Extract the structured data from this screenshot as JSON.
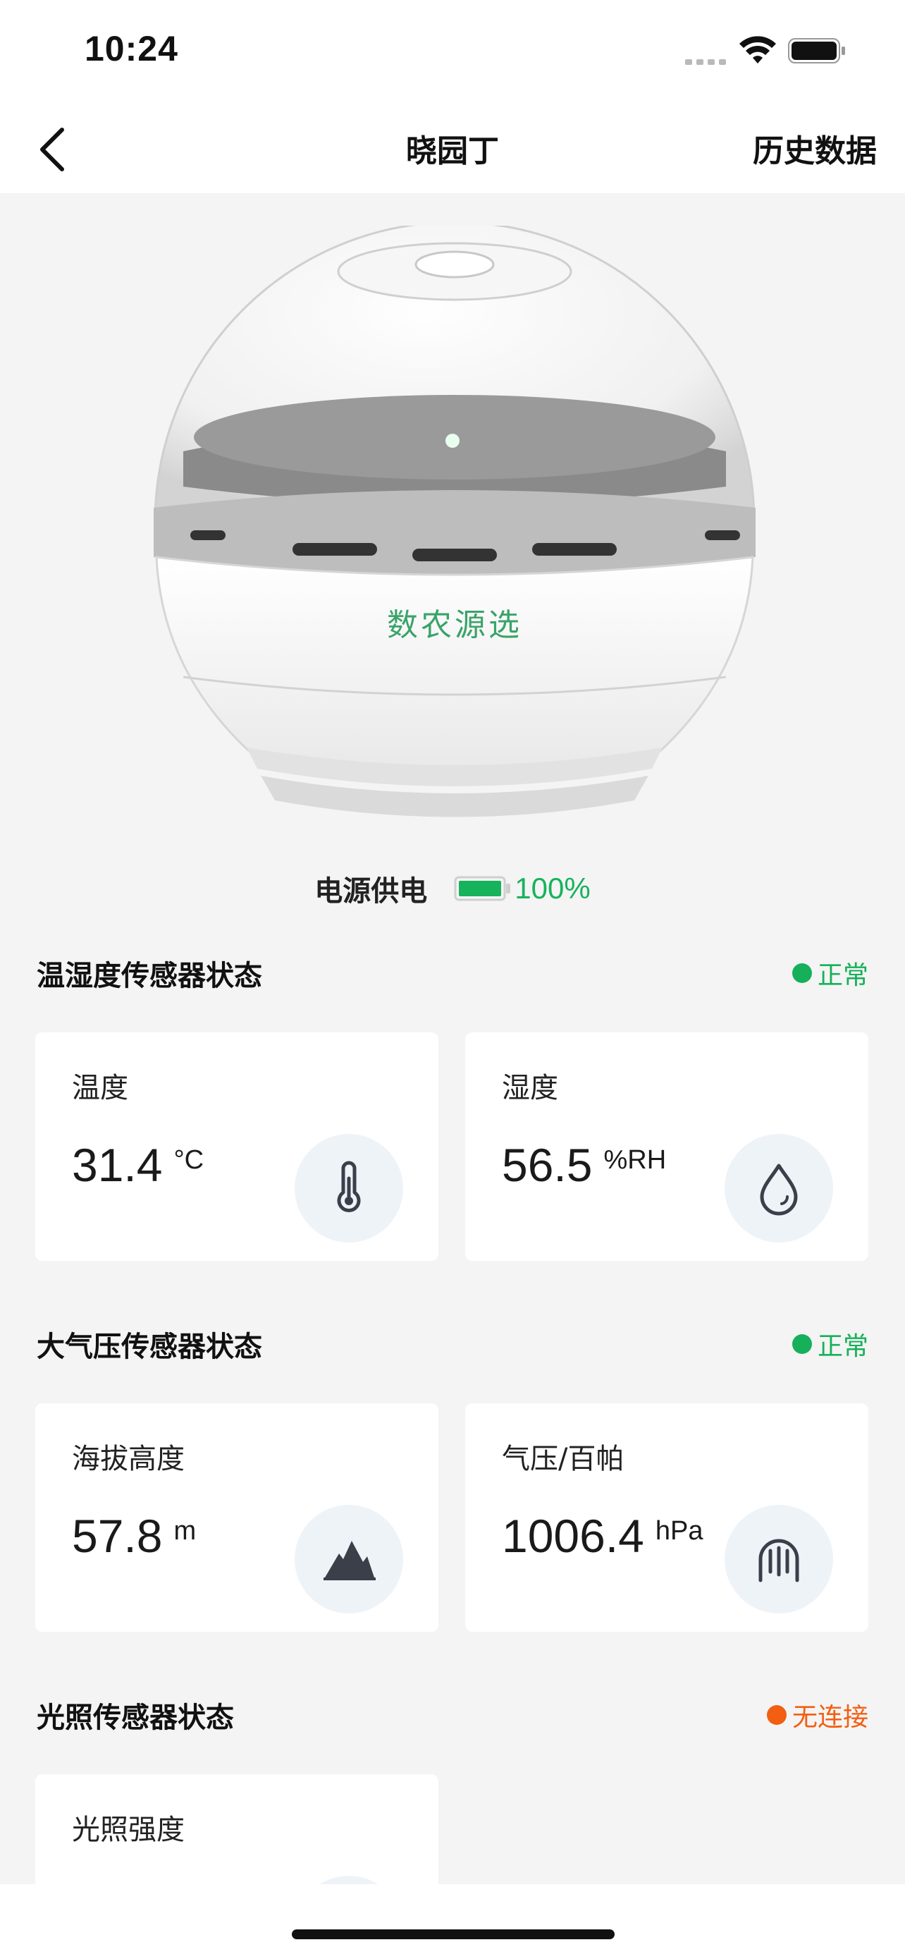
{
  "status_bar": {
    "time": "10:24"
  },
  "nav": {
    "title": "晓园丁",
    "right_action": "历史数据"
  },
  "device": {
    "brand": "数农源选"
  },
  "power": {
    "label": "电源供电",
    "percent": "100%",
    "level": 1.0
  },
  "sections": [
    {
      "title": "温湿度传感器状态",
      "status": "正常",
      "status_color": "#16b05a",
      "cards": [
        {
          "label": "温度",
          "value": "31.4",
          "unit": "°C",
          "icon": "thermometer-icon"
        },
        {
          "label": "湿度",
          "value": "56.5",
          "unit": "%RH",
          "icon": "water-drop-icon"
        }
      ]
    },
    {
      "title": "大气压传感器状态",
      "status": "正常",
      "status_color": "#16b05a",
      "cards": [
        {
          "label": "海拔高度",
          "value": "57.8",
          "unit": "m",
          "icon": "mountain-icon"
        },
        {
          "label": "气压/百帕",
          "value": "1006.4",
          "unit": "hPa",
          "icon": "pressure-icon"
        }
      ]
    },
    {
      "title": "光照传感器状态",
      "status": "无连接",
      "status_color": "#f25f12",
      "cards": [
        {
          "label": "光照强度",
          "icon": "light-icon"
        }
      ]
    }
  ],
  "colors": {
    "accent_green": "#17b25c",
    "warning_orange": "#f25f12",
    "page_bg": "#f4f4f4"
  }
}
